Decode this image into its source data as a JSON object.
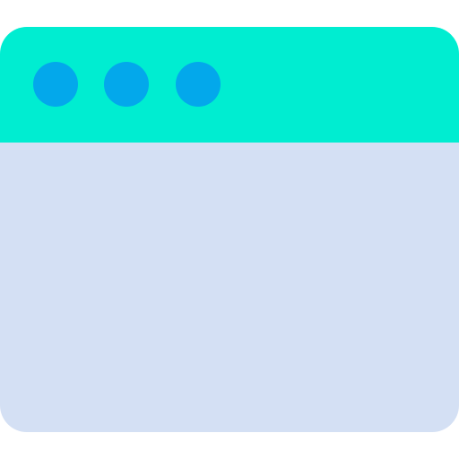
{
  "colors": {
    "titlebar": "#00EDD1",
    "content": "#D4E0F4",
    "dots": "#03A8EB"
  },
  "icon": "browser-window-icon"
}
